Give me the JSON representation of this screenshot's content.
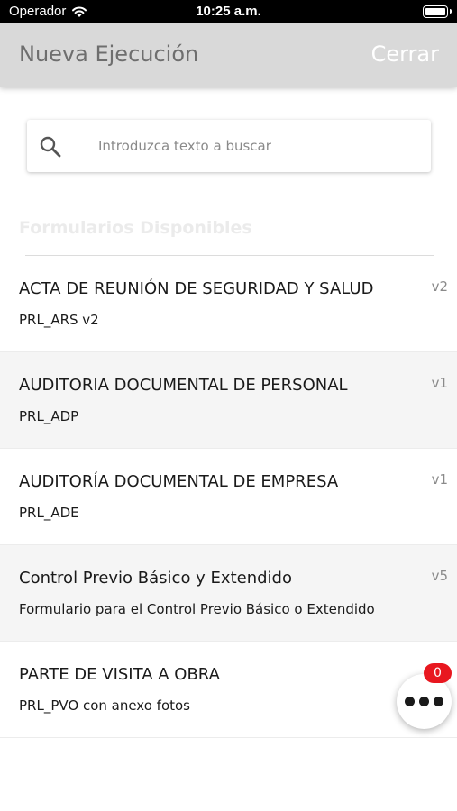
{
  "status_bar": {
    "carrier": "Operador",
    "time": "10:25 a.m.",
    "wifi_icon": "wifi-icon",
    "battery_icon": "battery-icon"
  },
  "nav": {
    "title": "Nueva Ejecución",
    "close_label": "Cerrar"
  },
  "search": {
    "placeholder": "Introduzca texto a buscar",
    "value": "",
    "icon": "search-icon"
  },
  "section": {
    "title": "Formularios Disponibles"
  },
  "forms": [
    {
      "name": "ACTA DE REUNIÓN DE SEGURIDAD Y SALUD",
      "code": "PRL_ARS v2",
      "version": "v2"
    },
    {
      "name": "AUDITORIA DOCUMENTAL DE PERSONAL",
      "code": "PRL_ADP",
      "version": "v1"
    },
    {
      "name": "AUDITORÍA DOCUMENTAL DE EMPRESA",
      "code": "PRL_ADE",
      "version": "v1"
    },
    {
      "name": "Control Previo Básico y Extendido",
      "code": "Formulario para el Control Previo Básico o Extendido",
      "version": "v5"
    },
    {
      "name": "PARTE DE VISITA A OBRA",
      "code": "PRL_PVO con anexo fotos",
      "version": ""
    }
  ],
  "fab": {
    "badge_count": "0",
    "icon": "more-dots-icon"
  },
  "colors": {
    "nav_background": "#d9d9d9",
    "badge": "#e8171f",
    "alt_row": "#f5f5f5"
  }
}
